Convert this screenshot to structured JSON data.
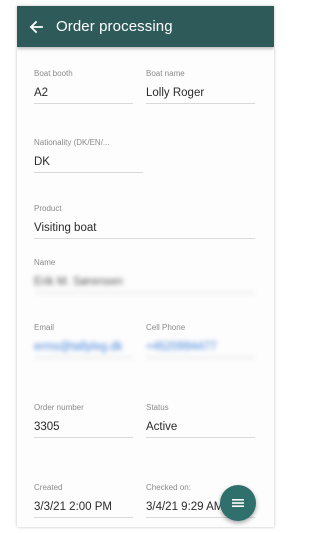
{
  "appbar": {
    "title": "Order processing",
    "back_icon": "arrow-left-icon",
    "color": "#2f5a5a"
  },
  "fields": {
    "boat_booth": {
      "label": "Boat booth",
      "value": "A2"
    },
    "boat_name": {
      "label": "Boat name",
      "value": "Lolly Roger"
    },
    "nationality": {
      "label": "Nationality (DK/EN/...",
      "value": "DK"
    },
    "product": {
      "label": "Product",
      "value": "Visiting boat"
    },
    "name": {
      "label": "Name",
      "value": "Erik M. Sørensen"
    },
    "email": {
      "label": "Email",
      "value": "erms@tallyleg.dk"
    },
    "cell_phone": {
      "label": "Cell Phone",
      "value": "+4520994477"
    },
    "order_number": {
      "label": "Order number",
      "value": "3305"
    },
    "status": {
      "label": "Status",
      "value": "Active"
    },
    "created": {
      "label": "Created",
      "value": "3/3/21 2:00 PM"
    },
    "checked_on": {
      "label": "Checked on:",
      "value": "3/4/21 9:29 AM"
    }
  },
  "fab": {
    "icon": "menu-icon",
    "color": "#2f6f6c"
  }
}
